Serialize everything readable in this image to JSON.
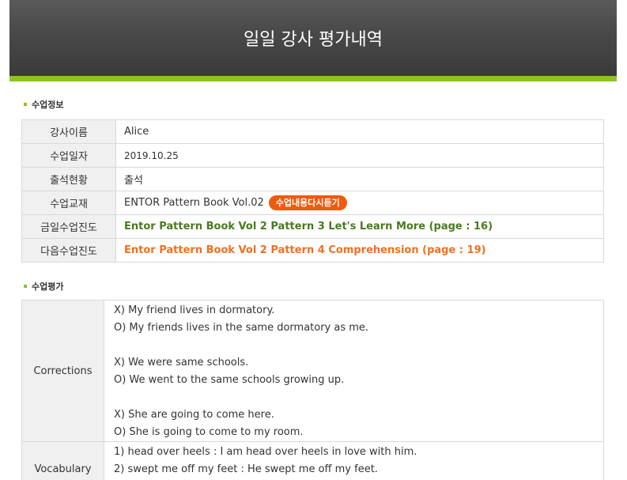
{
  "header": {
    "title": "일일 강사 평가내역"
  },
  "colors": {
    "accent_green": "#8ec31f",
    "button_orange": "#f05a10",
    "progress_green": "#4a7a1e",
    "next_orange": "#f07020"
  },
  "class_info": {
    "section_title": "수업정보",
    "rows": [
      {
        "label": "강사이름",
        "value": "Alice"
      },
      {
        "label": "수업일자",
        "value": "2019.10.25"
      },
      {
        "label": "출석현황",
        "value": "출석"
      },
      {
        "label": "수업교재",
        "value": "ENTOR Pattern Book Vol.02",
        "button": "수업내용다시듣기"
      },
      {
        "label": "금일수업진도",
        "value": "Entor Pattern Book Vol 2 Pattern 3 Let's Learn More (page : 16)"
      },
      {
        "label": "다음수업진도",
        "value": "Entor Pattern Book Vol 2 Pattern 4 Comprehension (page : 19)"
      }
    ]
  },
  "evaluation": {
    "section_title": "수업평가",
    "corrections": {
      "label": "Corrections",
      "lines": [
        "X) My friend lives in dormatory.",
        "O) My friends lives in the same dormatory as me.",
        "X) We were same schools.",
        "O) We went to the same schools growing up.",
        "X) She are going to come here.",
        "O) She is going to come to my room."
      ]
    },
    "vocabulary": {
      "label": "Vocabulary",
      "lines": [
        "1) head over heels : I am head over heels in love with him.",
        "2) swept me off my feet : He swept me off my feet."
      ]
    }
  }
}
